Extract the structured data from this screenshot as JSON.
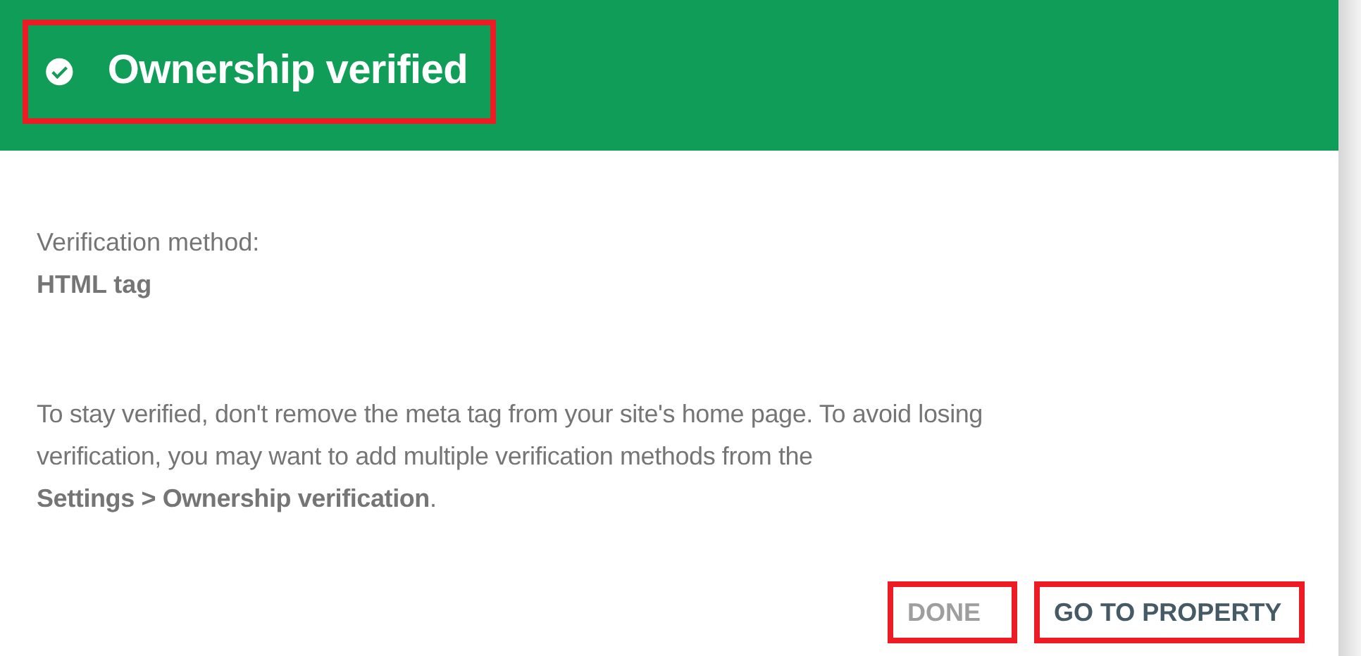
{
  "header": {
    "title": "Ownership verified",
    "highlighted": true
  },
  "method": {
    "label": "Verification method:",
    "value": "HTML tag"
  },
  "message": "To stay verified, don't remove the meta tag from your site's home page. To avoid losing\nverification, you may want to add multiple verification methods from the\n**Settings > Ownership verification**.",
  "buttons": [
    {
      "label": "DONE",
      "kind": "secondary",
      "highlighted": true
    },
    {
      "label": "GO TO PROPERTY",
      "kind": "primary",
      "highlighted": true
    }
  ]
}
